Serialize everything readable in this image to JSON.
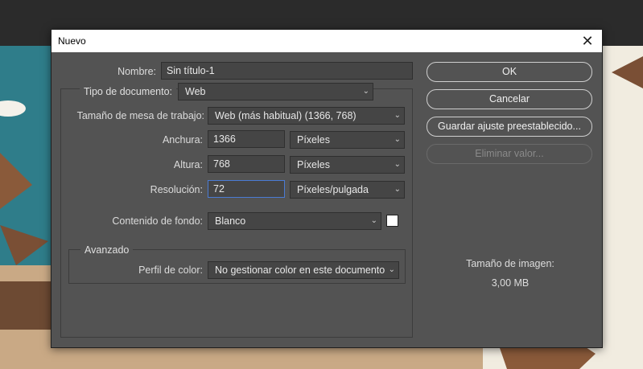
{
  "dialog": {
    "title": "Nuevo",
    "close_glyph": "✕"
  },
  "form": {
    "nombre_label": "Nombre:",
    "nombre_value": "Sin título-1",
    "tipo_label": "Tipo de documento:",
    "tipo_value": "Web",
    "tamano_label": "Tamaño de mesa de trabajo:",
    "tamano_value": "Web (más habitual) (1366, 768)",
    "anchura_label": "Anchura:",
    "anchura_value": "1366",
    "anchura_unit": "Píxeles",
    "altura_label": "Altura:",
    "altura_value": "768",
    "altura_unit": "Píxeles",
    "resolucion_label": "Resolución:",
    "resolucion_value": "72",
    "resolucion_unit": "Píxeles/pulgada",
    "contenido_label": "Contenido de fondo:",
    "contenido_value": "Blanco",
    "avanzado_title": "Avanzado",
    "perfil_label": "Perfil de color:",
    "perfil_value": "No gestionar color en este documento"
  },
  "buttons": {
    "ok": "OK",
    "cancel": "Cancelar",
    "save_preset": "Guardar ajuste preestablecido...",
    "delete_preset": "Eliminar valor..."
  },
  "info": {
    "image_size_label": "Tamaño de imagen:",
    "image_size_value": "3,00 MB"
  },
  "colors": {
    "dialog_bg": "#535353",
    "swatch": "#ffffff",
    "focus": "#4a7bd4"
  }
}
